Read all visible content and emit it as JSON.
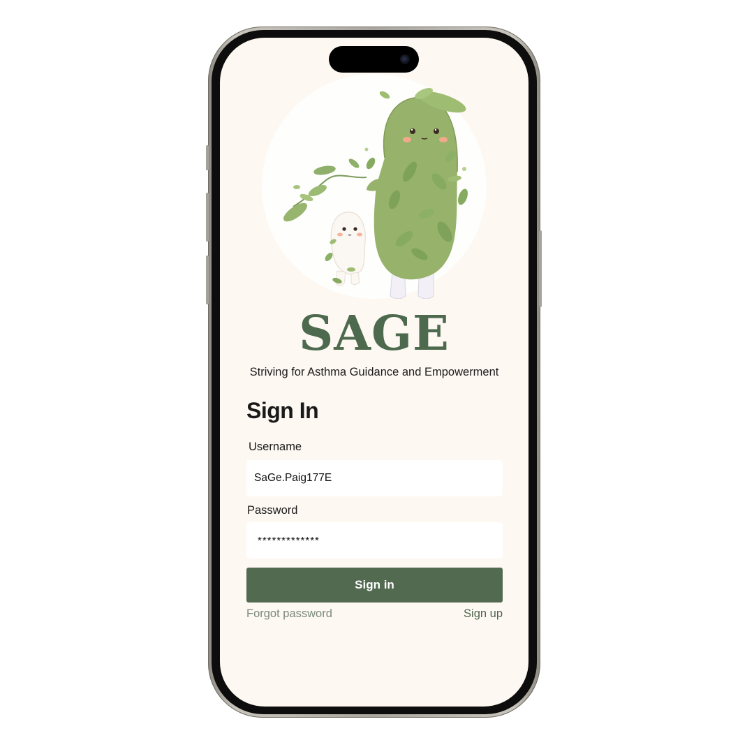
{
  "app": {
    "title": "SAGE",
    "tagline": "Striving for Asthma Guidance and Empowerment"
  },
  "hero": {
    "description_icon": "plant-mascot-illustration"
  },
  "form": {
    "heading": "Sign In",
    "username_label": "Username",
    "username_value": "SaGe.Paig177E",
    "password_label": "Password",
    "password_value": "*************",
    "submit_label": "Sign in",
    "forgot_label": "Forgot password",
    "signup_label": "Sign up"
  },
  "colors": {
    "brand_green": "#526a50",
    "title_green": "#4e6a4e",
    "screen_background": "#fdf8f2",
    "link_muted": "#7b8a7a"
  }
}
